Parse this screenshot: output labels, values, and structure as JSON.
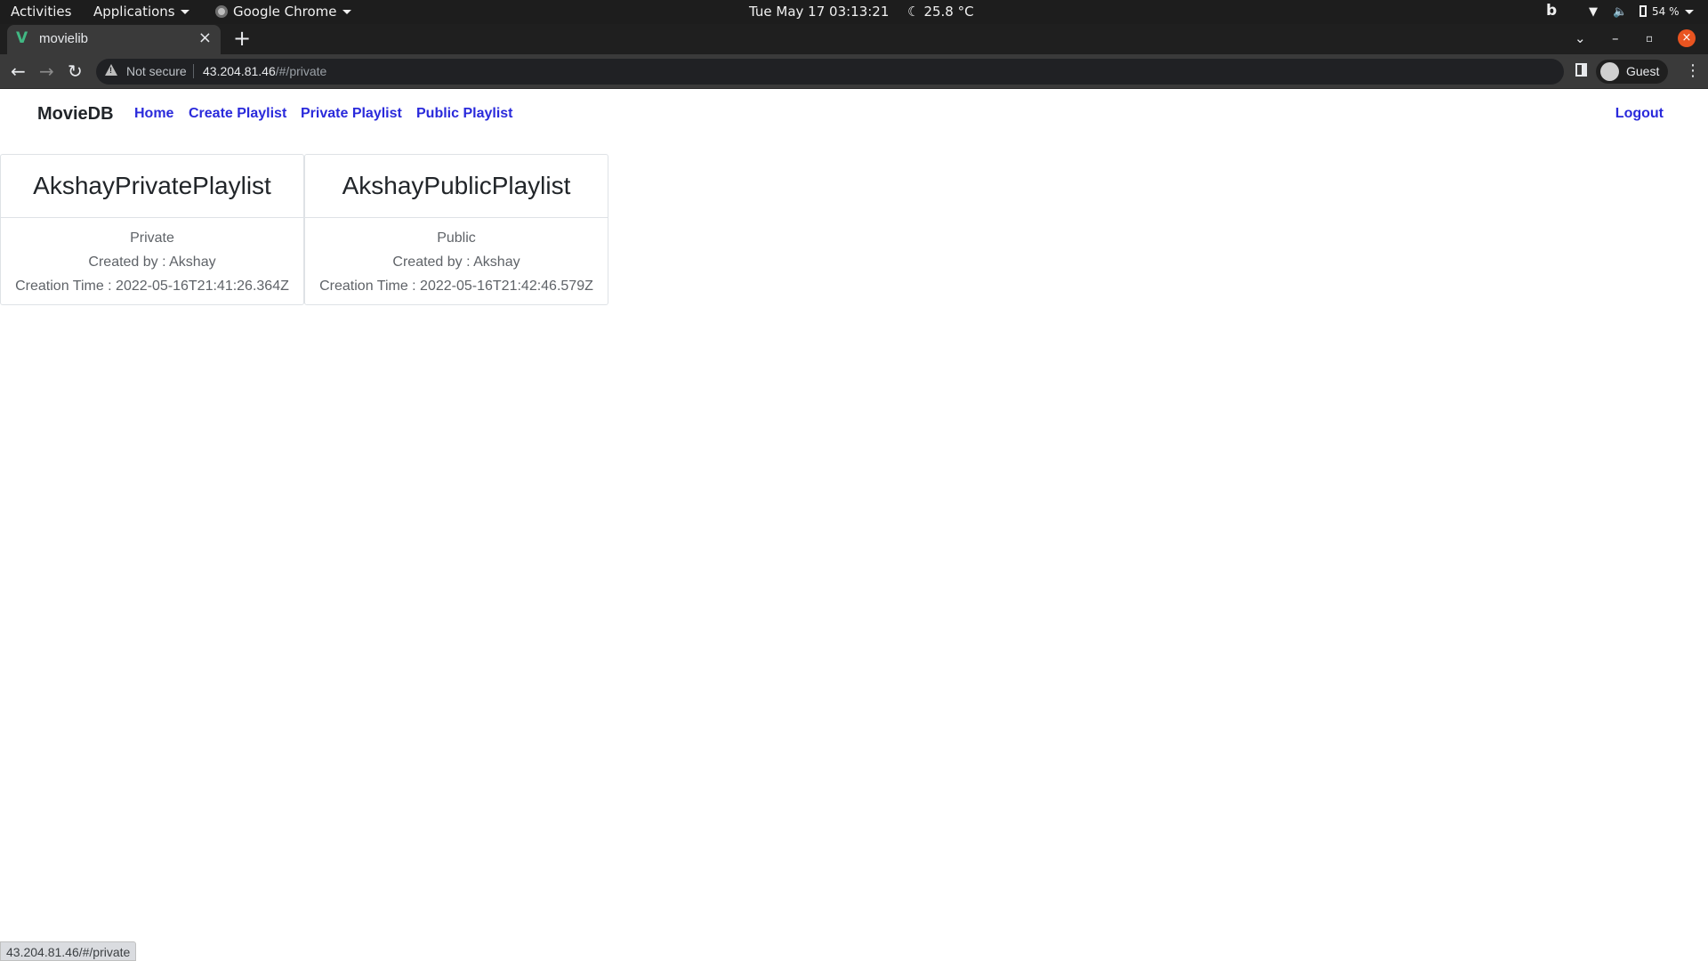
{
  "system": {
    "activities": "Activities",
    "applications": "Applications",
    "app_name": "Google Chrome",
    "datetime": "Tue May 17  03:13:21",
    "weather": "25.8 °C",
    "battery": "54 %"
  },
  "browser": {
    "tab_title": "movielib",
    "security_label": "Not secure",
    "url_host": "43.204.81.46",
    "url_path": "/#/private",
    "profile": "Guest",
    "status_url": "43.204.81.46/#/private"
  },
  "app": {
    "brand": "MovieDB",
    "nav": [
      "Home",
      "Create Playlist",
      "Private Playlist",
      "Public Playlist"
    ],
    "logout": "Logout",
    "playlists": [
      {
        "title": "AkshayPrivatePlaylist",
        "visibility": "Private",
        "created_by": "Created by : Akshay",
        "creation_time": "Creation Time : 2022-05-16T21:41:26.364Z"
      },
      {
        "title": "AkshayPublicPlaylist",
        "visibility": "Public",
        "created_by": "Created by : Akshay",
        "creation_time": "Creation Time : 2022-05-16T21:42:46.579Z"
      }
    ]
  }
}
